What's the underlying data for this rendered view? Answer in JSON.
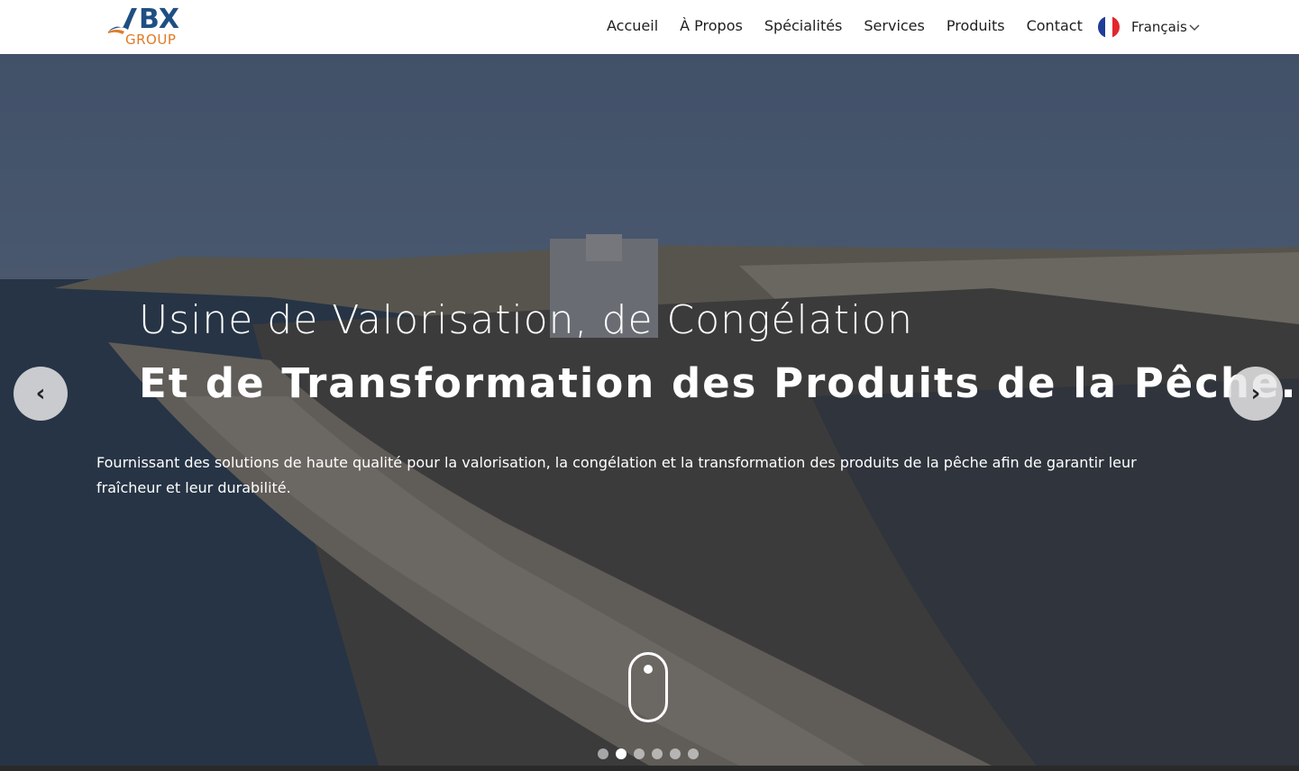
{
  "header": {
    "logo": {
      "main": "BX",
      "sub": "GROUP"
    },
    "nav": [
      "Accueil",
      "À Propos",
      "Spécialités",
      "Services",
      "Produits",
      "Contact"
    ],
    "language": {
      "label": "Français",
      "flag_colors": [
        "#1f3d99",
        "#ffffff",
        "#e1262d"
      ]
    }
  },
  "hero": {
    "title_line1": "Usine de Valorisation, de Congélation",
    "title_line2": "Et de Transformation des Produits de la Pêche.",
    "description": "Fournissant des solutions de haute qualité pour la valorisation, la congélation et la transformation des produits de la pêche afin de garantir leur fraîcheur et leur durabilité.",
    "prev_label": "‹",
    "next_label": "›",
    "slides": {
      "count": 6,
      "active_index": 1
    }
  },
  "icons": {
    "prev": "chevron-left-icon",
    "next": "chevron-right-icon",
    "scroll": "mouse-scroll-icon",
    "dropdown": "chevron-down-icon"
  }
}
